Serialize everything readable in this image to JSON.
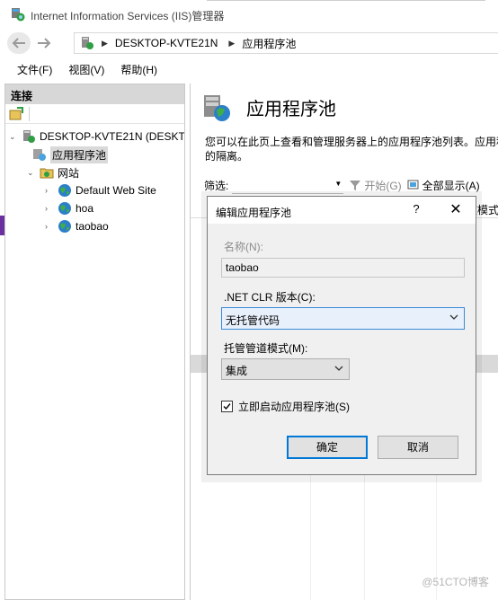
{
  "window": {
    "title": "Internet Information Services (IIS)管理器"
  },
  "address": {
    "crumbs": [
      "DESKTOP-KVTE21N",
      "应用程序池"
    ]
  },
  "menu": {
    "file": "文件(F)",
    "view": "视图(V)",
    "help": "帮助(H)"
  },
  "connections": {
    "header": "连接",
    "tree": {
      "server": "DESKTOP-KVTE21N (DESKT",
      "app_pools": "应用程序池",
      "sites": "网站",
      "site_items": [
        "Default Web Site",
        "hoa",
        "taobao"
      ]
    }
  },
  "main": {
    "title": "应用程序池",
    "description_line1": "您可以在此页上查看和管理服务器上的应用程序池列表。应用程",
    "description_line2": "的隔离。",
    "filter_label": "筛选:",
    "start_label": "开始(G)",
    "show_all_label": "全部显示(A)",
    "column_stub": "道模式"
  },
  "dialog": {
    "title": "编辑应用程序池",
    "help": "?",
    "close": "✕",
    "name_label": "名称(N):",
    "name_value": "taobao",
    "clr_label": ".NET CLR 版本(C):",
    "clr_value": "无托管代码",
    "pipeline_label": "托管管道模式(M):",
    "pipeline_value": "集成",
    "autostart_label": "立即启动应用程序池(S)",
    "autostart_checked": true,
    "ok_label": "确定",
    "cancel_label": "取消"
  },
  "watermark": "@51CTO博客"
}
